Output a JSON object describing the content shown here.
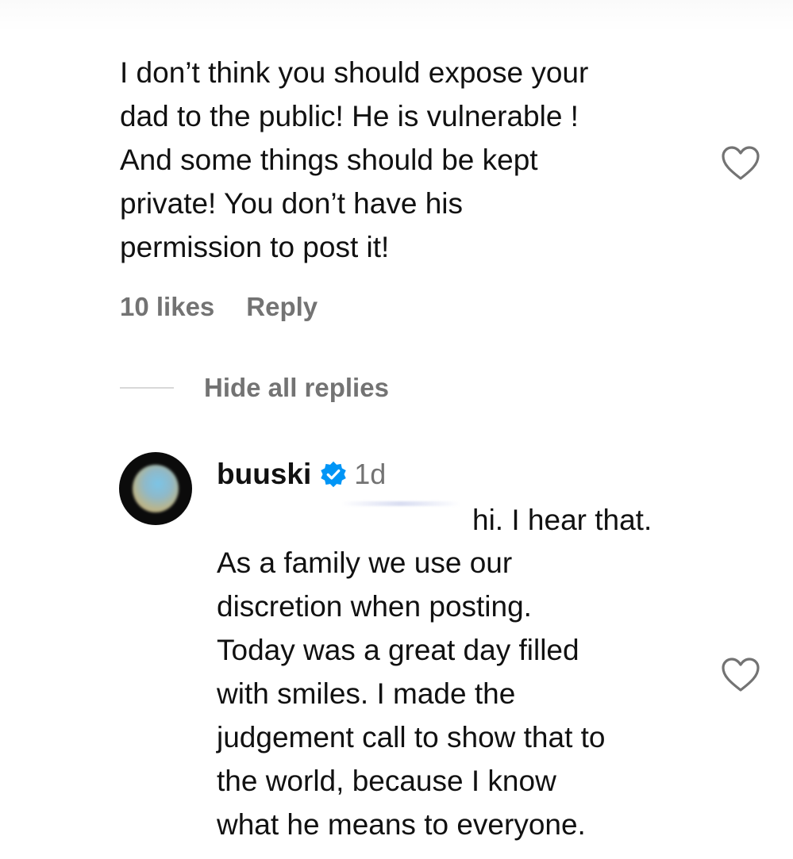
{
  "comment": {
    "lines": [
      "I don’t think you should expose your",
      "dad to the public! He is vulnerable !",
      "And some things should be kept",
      "private! You don’t have his",
      "permission to post it!"
    ],
    "likes_label": "10 likes",
    "reply_label": "Reply",
    "like_icon": "heart-outline-icon"
  },
  "replies_toggle": {
    "label": "Hide all replies"
  },
  "reply": {
    "username": "buuski",
    "verified_icon": "verified-badge-icon",
    "verified_color": "#0095f6",
    "timestamp": "1d",
    "first_line": "hi. I hear that.",
    "lines": [
      "As a family we use our",
      "discretion when posting.",
      "Today was a great day filled",
      "with smiles. I made the",
      "judgement call to show that to",
      "the world, because I know",
      "what he means to everyone."
    ],
    "like_icon": "heart-outline-icon"
  },
  "colors": {
    "text": "#111111",
    "muted": "#737373",
    "divider": "#d8d8d8"
  }
}
